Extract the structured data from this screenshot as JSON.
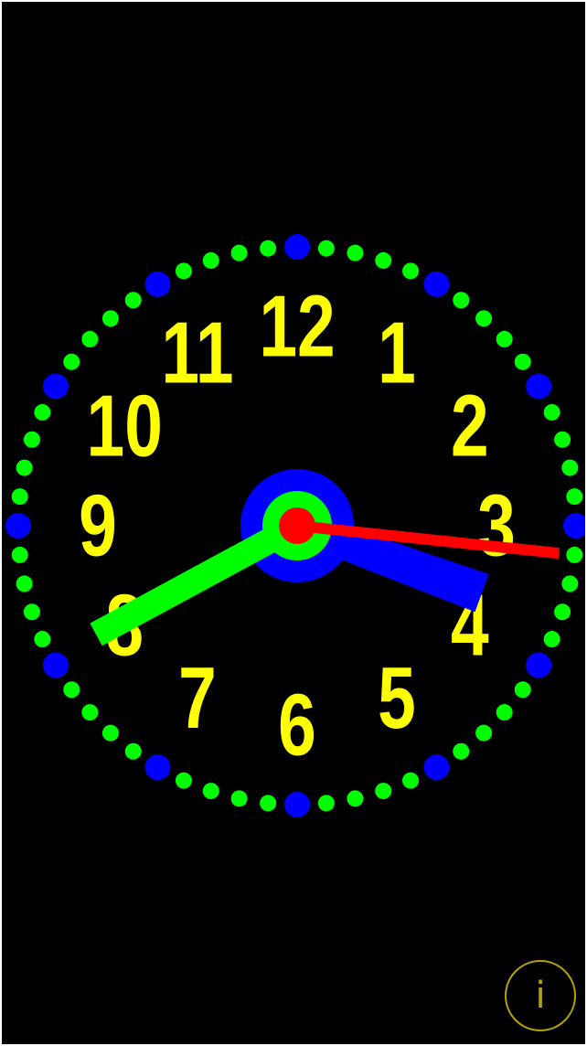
{
  "clock": {
    "numerals": [
      "12",
      "1",
      "2",
      "3",
      "4",
      "5",
      "6",
      "7",
      "8",
      "9",
      "10",
      "11"
    ],
    "time": {
      "hour": 3,
      "minute": 40,
      "second": 16
    },
    "colors": {
      "background": "#000000",
      "numerals": "#ffff00",
      "hour_hand": "#0000ff",
      "minute_hand": "#00ff00",
      "second_hand": "#ff0000",
      "hour_dots": "#0000ff",
      "minute_dots": "#00ff00",
      "hub_outer": "#0000ff",
      "hub_middle": "#00ff00",
      "hub_inner": "#ff0000"
    }
  },
  "info_button": {
    "icon": "info-icon",
    "label": "i",
    "color": "#b8a400"
  }
}
